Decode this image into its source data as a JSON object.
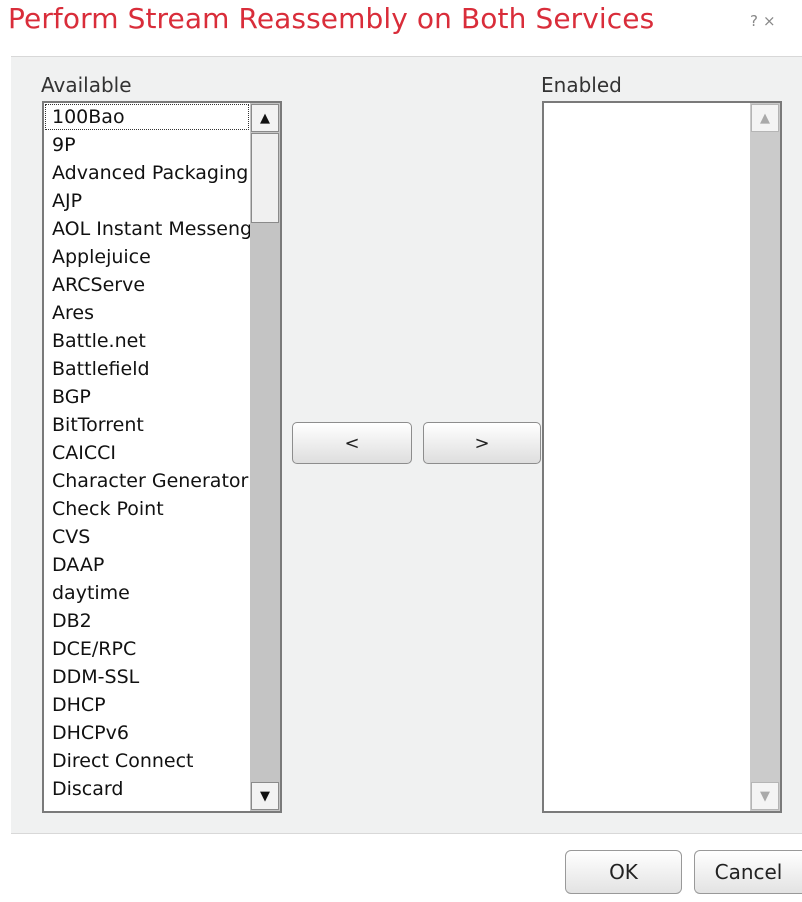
{
  "dialog": {
    "title": "Perform Stream Reassembly on Both Services",
    "help_glyph": "?",
    "close_glyph": "×"
  },
  "available": {
    "label": "Available",
    "items": [
      "100Bao",
      "9P",
      "Advanced Packaging Tool",
      "AJP",
      "AOL Instant Messenger",
      "Applejuice",
      "ARCServe",
      "Ares",
      "Battle.net",
      "Battlefield",
      "BGP",
      "BitTorrent",
      "CAICCI",
      "Character Generator",
      "Check Point",
      "CVS",
      "DAAP",
      "daytime",
      "DB2",
      "DCE/RPC",
      "DDM-SSL",
      "DHCP",
      "DHCPv6",
      "Direct Connect",
      "Discard"
    ],
    "focused_item": "100Bao"
  },
  "enabled": {
    "label": "Enabled",
    "items": []
  },
  "move_buttons": {
    "remove": "<",
    "add": ">"
  },
  "footer": {
    "ok": "OK",
    "cancel": "Cancel"
  },
  "icons": {
    "scroll_up": "scroll-up-arrow-icon",
    "scroll_down": "scroll-down-arrow-icon"
  },
  "colors": {
    "title": "#d92d3a",
    "panel": "#f0f1f1"
  }
}
